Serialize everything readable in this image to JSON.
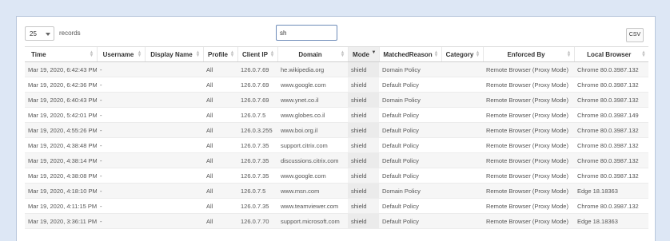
{
  "controls": {
    "page_length": "25",
    "records_label": "records",
    "search_value": "sh",
    "csv_label": "CSV"
  },
  "table": {
    "columns": [
      "Time",
      "Username",
      "Display Name",
      "Profile",
      "Client IP",
      "Domain",
      "Mode",
      "MatchedReason",
      "Category",
      "Enforced By",
      "Local Browser"
    ],
    "sorted_column": "Mode",
    "rows": [
      [
        "Mar 19, 2020, 6:42:43 PM",
        "-",
        "",
        "All",
        "126.0.7.69",
        "he.wikipedia.org",
        "shield",
        "Domain Policy",
        "",
        "Remote Browser (Proxy Mode)",
        "Chrome 80.0.3987.132"
      ],
      [
        "Mar 19, 2020, 6:42:36 PM",
        "-",
        "",
        "All",
        "126.0.7.69",
        "www.google.com",
        "shield",
        "Default Policy",
        "",
        "Remote Browser (Proxy Mode)",
        "Chrome 80.0.3987.132"
      ],
      [
        "Mar 19, 2020, 6:40:43 PM",
        "-",
        "",
        "All",
        "126.0.7.69",
        "www.ynet.co.il",
        "shield",
        "Domain Policy",
        "",
        "Remote Browser (Proxy Mode)",
        "Chrome 80.0.3987.132"
      ],
      [
        "Mar 19, 2020, 5:42:01 PM",
        "-",
        "",
        "All",
        "126.0.7.5",
        "www.globes.co.il",
        "shield",
        "Default Policy",
        "",
        "Remote Browser (Proxy Mode)",
        "Chrome 80.0.3987.149"
      ],
      [
        "Mar 19, 2020, 4:55:26 PM",
        "-",
        "",
        "All",
        "126.0.3.255",
        "www.boi.org.il",
        "shield",
        "Default Policy",
        "",
        "Remote Browser (Proxy Mode)",
        "Chrome 80.0.3987.132"
      ],
      [
        "Mar 19, 2020, 4:38:48 PM",
        "-",
        "",
        "All",
        "126.0.7.35",
        "support.citrix.com",
        "shield",
        "Default Policy",
        "",
        "Remote Browser (Proxy Mode)",
        "Chrome 80.0.3987.132"
      ],
      [
        "Mar 19, 2020, 4:38:14 PM",
        "-",
        "",
        "All",
        "126.0.7.35",
        "discussions.citrix.com",
        "shield",
        "Default Policy",
        "",
        "Remote Browser (Proxy Mode)",
        "Chrome 80.0.3987.132"
      ],
      [
        "Mar 19, 2020, 4:38:08 PM",
        "-",
        "",
        "All",
        "126.0.7.35",
        "www.google.com",
        "shield",
        "Default Policy",
        "",
        "Remote Browser (Proxy Mode)",
        "Chrome 80.0.3987.132"
      ],
      [
        "Mar 19, 2020, 4:18:10 PM",
        "-",
        "",
        "All",
        "126.0.7.5",
        "www.msn.com",
        "shield",
        "Domain Policy",
        "",
        "Remote Browser (Proxy Mode)",
        "Edge 18.18363"
      ],
      [
        "Mar 19, 2020, 4:11:15 PM",
        "-",
        "",
        "All",
        "126.0.7.35",
        "www.teamviewer.com",
        "shield",
        "Default Policy",
        "",
        "Remote Browser (Proxy Mode)",
        "Chrome 80.0.3987.132"
      ],
      [
        "Mar 19, 2020, 3:36:11 PM",
        "-",
        "",
        "All",
        "126.0.7.70",
        "support.microsoft.com",
        "shield",
        "Default Policy",
        "",
        "Remote Browser (Proxy Mode)",
        "Edge 18.18363"
      ]
    ]
  }
}
